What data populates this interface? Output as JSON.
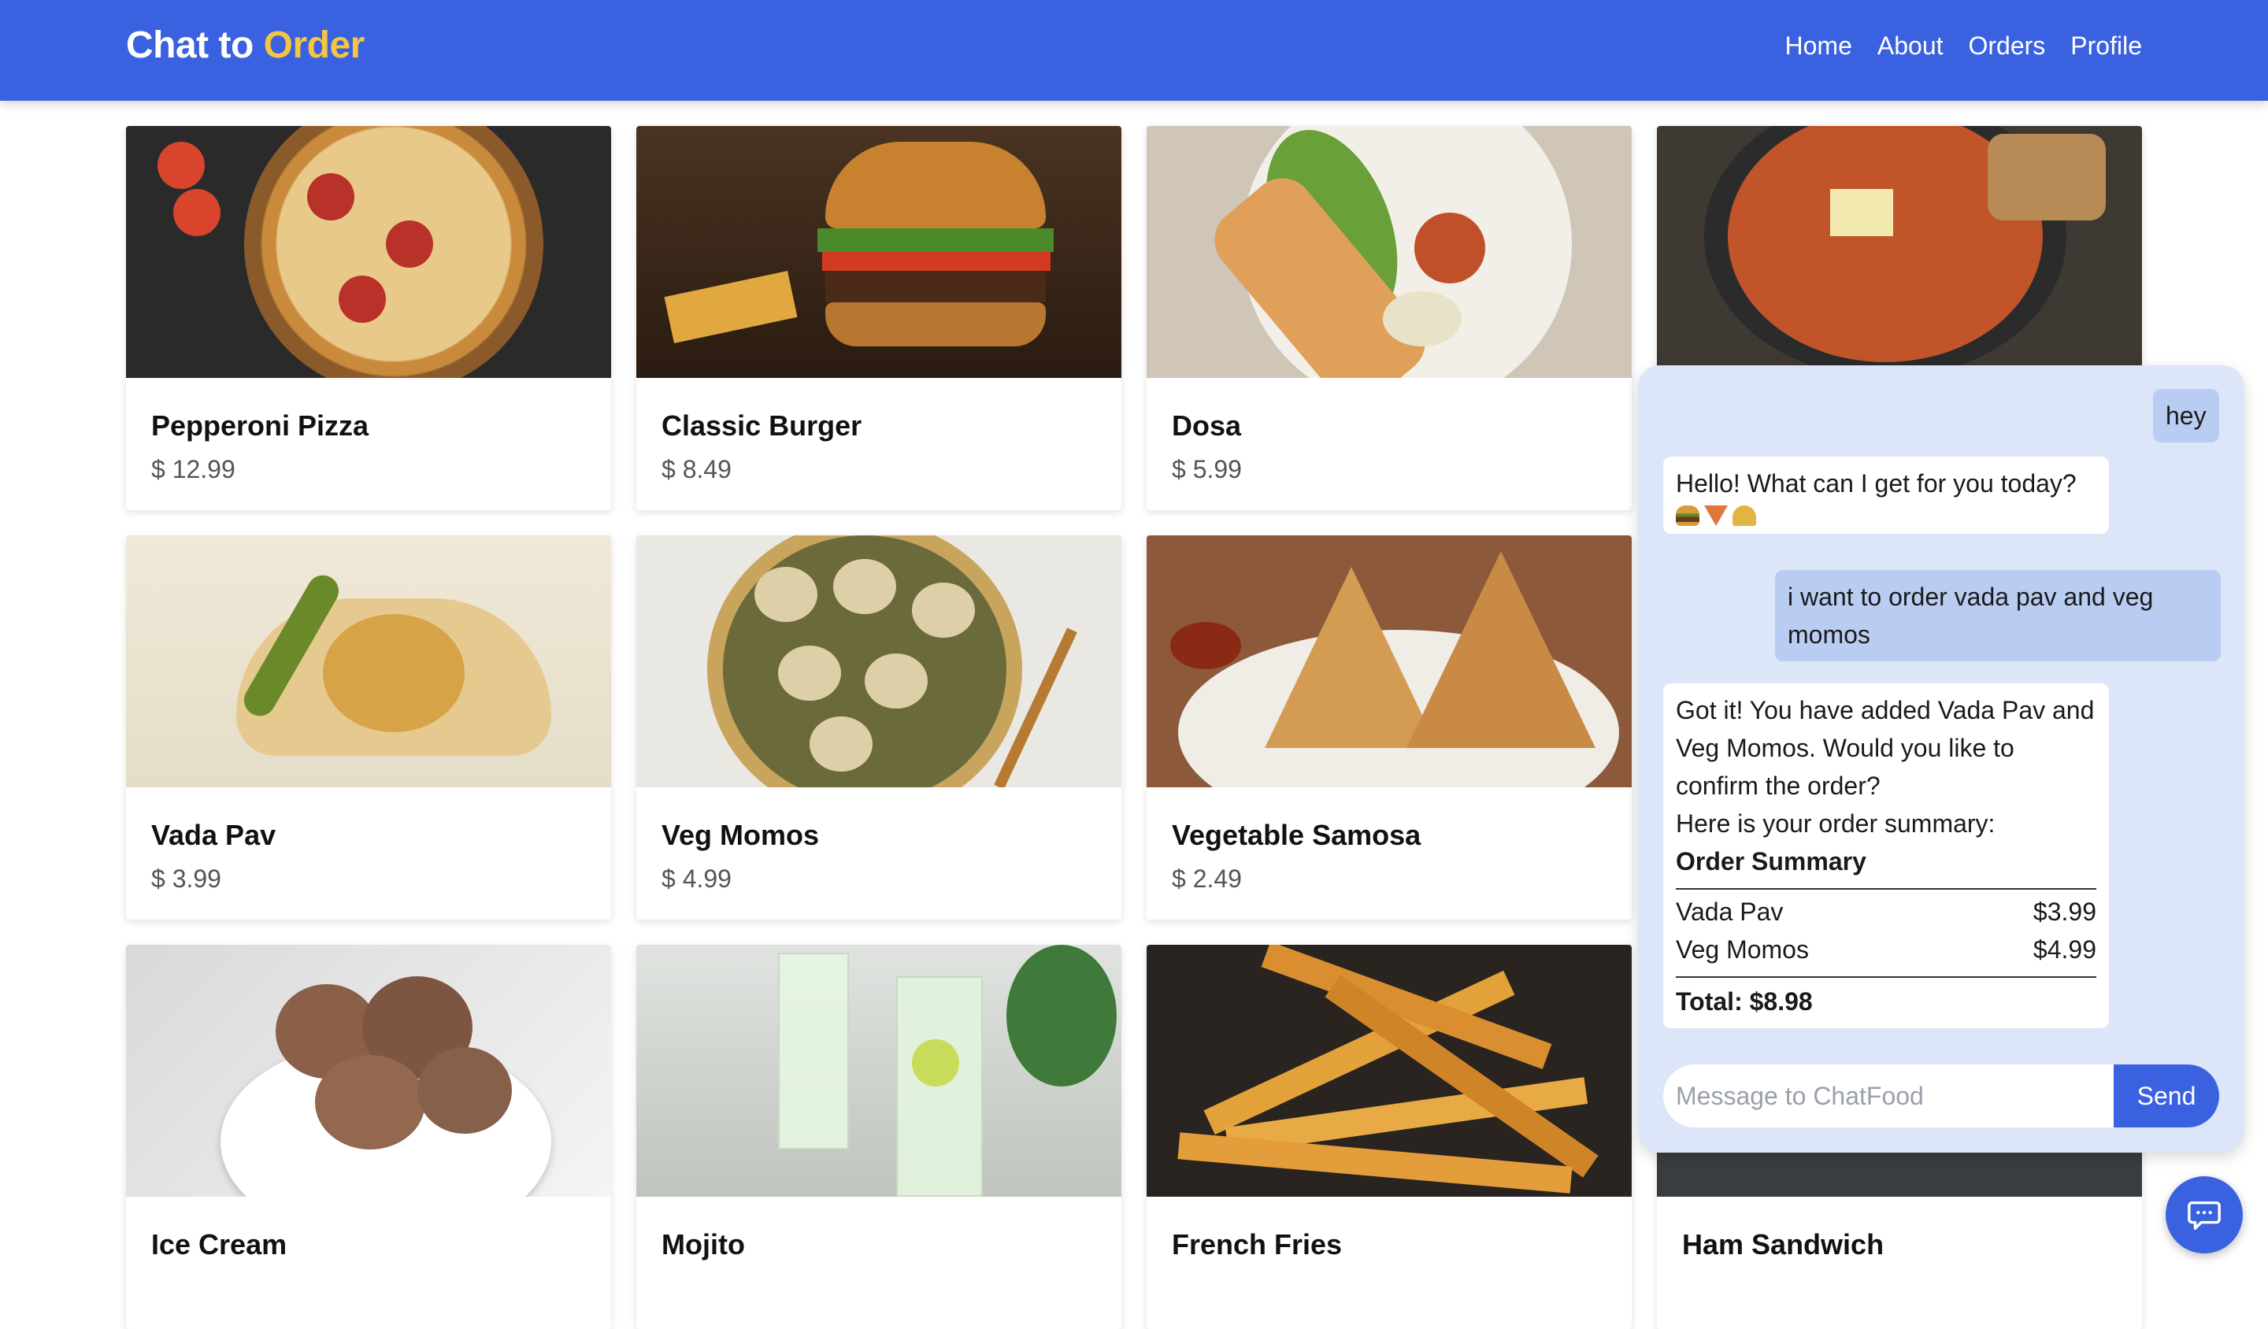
{
  "header": {
    "brand_part1": "Chat to ",
    "brand_part2": "Order",
    "nav": [
      "Home",
      "About",
      "Orders",
      "Profile"
    ]
  },
  "menu": [
    {
      "name": "Pepperoni Pizza",
      "price": "$ 12.99"
    },
    {
      "name": "Classic Burger",
      "price": "$ 8.49"
    },
    {
      "name": "Dosa",
      "price": "$ 5.99"
    },
    {
      "name": "",
      "price": ""
    },
    {
      "name": "Vada Pav",
      "price": "$ 3.99"
    },
    {
      "name": "Veg Momos",
      "price": "$ 4.99"
    },
    {
      "name": "Vegetable Samosa",
      "price": "$ 2.49"
    },
    {
      "name": "",
      "price": ""
    },
    {
      "name": "Ice Cream",
      "price": ""
    },
    {
      "name": "Mojito",
      "price": ""
    },
    {
      "name": "French Fries",
      "price": ""
    },
    {
      "name": "Ham Sandwich",
      "price": ""
    }
  ],
  "chat": {
    "messages": [
      {
        "from": "user",
        "text": "hey"
      },
      {
        "from": "bot",
        "text": "Hello! What can I get for you today?"
      },
      {
        "from": "user",
        "text_line1": "i want to order vada pav and veg",
        "text_line2": "momos"
      },
      {
        "from": "bot",
        "lines": [
          "Got it! You have added Vada Pav and",
          "Veg Momos. Would you like to",
          "confirm the order?",
          "Here is your order summary:"
        ],
        "summary_title": "Order Summary",
        "items": [
          {
            "name": "Vada Pav",
            "price": "$3.99"
          },
          {
            "name": "Veg Momos",
            "price": "$4.99"
          }
        ],
        "total": "Total: $8.98"
      }
    ],
    "input_placeholder": "Message to ChatFood",
    "send_label": "Send"
  },
  "icons": {
    "fab": "chat-bubble-icon",
    "emojis": [
      "burger-icon",
      "pizza-icon",
      "taco-icon"
    ]
  },
  "colors": {
    "primary": "#3a62e0",
    "brand_accent": "#f5c542",
    "chat_bg": "#dce6f8",
    "user_bubble": "#b9cdf3"
  }
}
